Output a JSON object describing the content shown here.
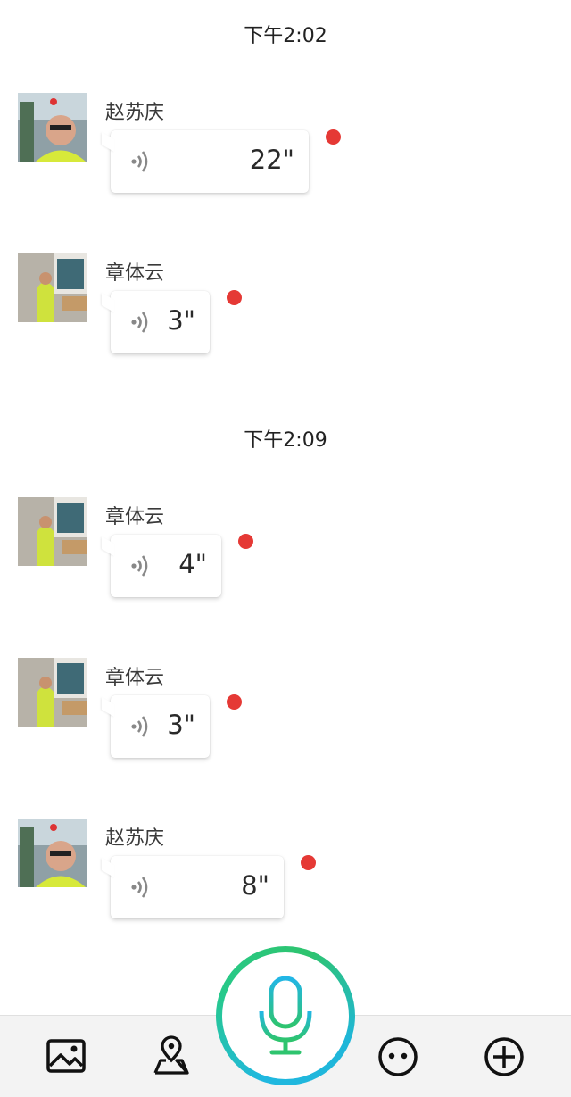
{
  "chat": {
    "timestamps": [
      "下午2:02",
      "下午2:09"
    ],
    "messages": [
      {
        "sender": "赵苏庆",
        "duration": "22\"",
        "avatar_icon": "avatar-man-photo"
      },
      {
        "sender": "章体云",
        "duration": "3\"",
        "avatar_icon": "avatar-worker-photo"
      },
      {
        "sender": "章体云",
        "duration": "4\"",
        "avatar_icon": "avatar-worker-photo"
      },
      {
        "sender": "章体云",
        "duration": "3\"",
        "avatar_icon": "avatar-worker-photo"
      },
      {
        "sender": "赵苏庆",
        "duration": "8\"",
        "avatar_icon": "avatar-man-photo"
      }
    ]
  },
  "toolbar": {
    "items": [
      "image-icon",
      "location-icon",
      "microphone-icon",
      "emoji-icon",
      "plus-icon"
    ]
  },
  "colors": {
    "unread_dot": "#e53935",
    "mic_gradient": [
      "#20b8e0",
      "#2ec46e"
    ],
    "toolbar_bg": "#f3f3f3"
  }
}
